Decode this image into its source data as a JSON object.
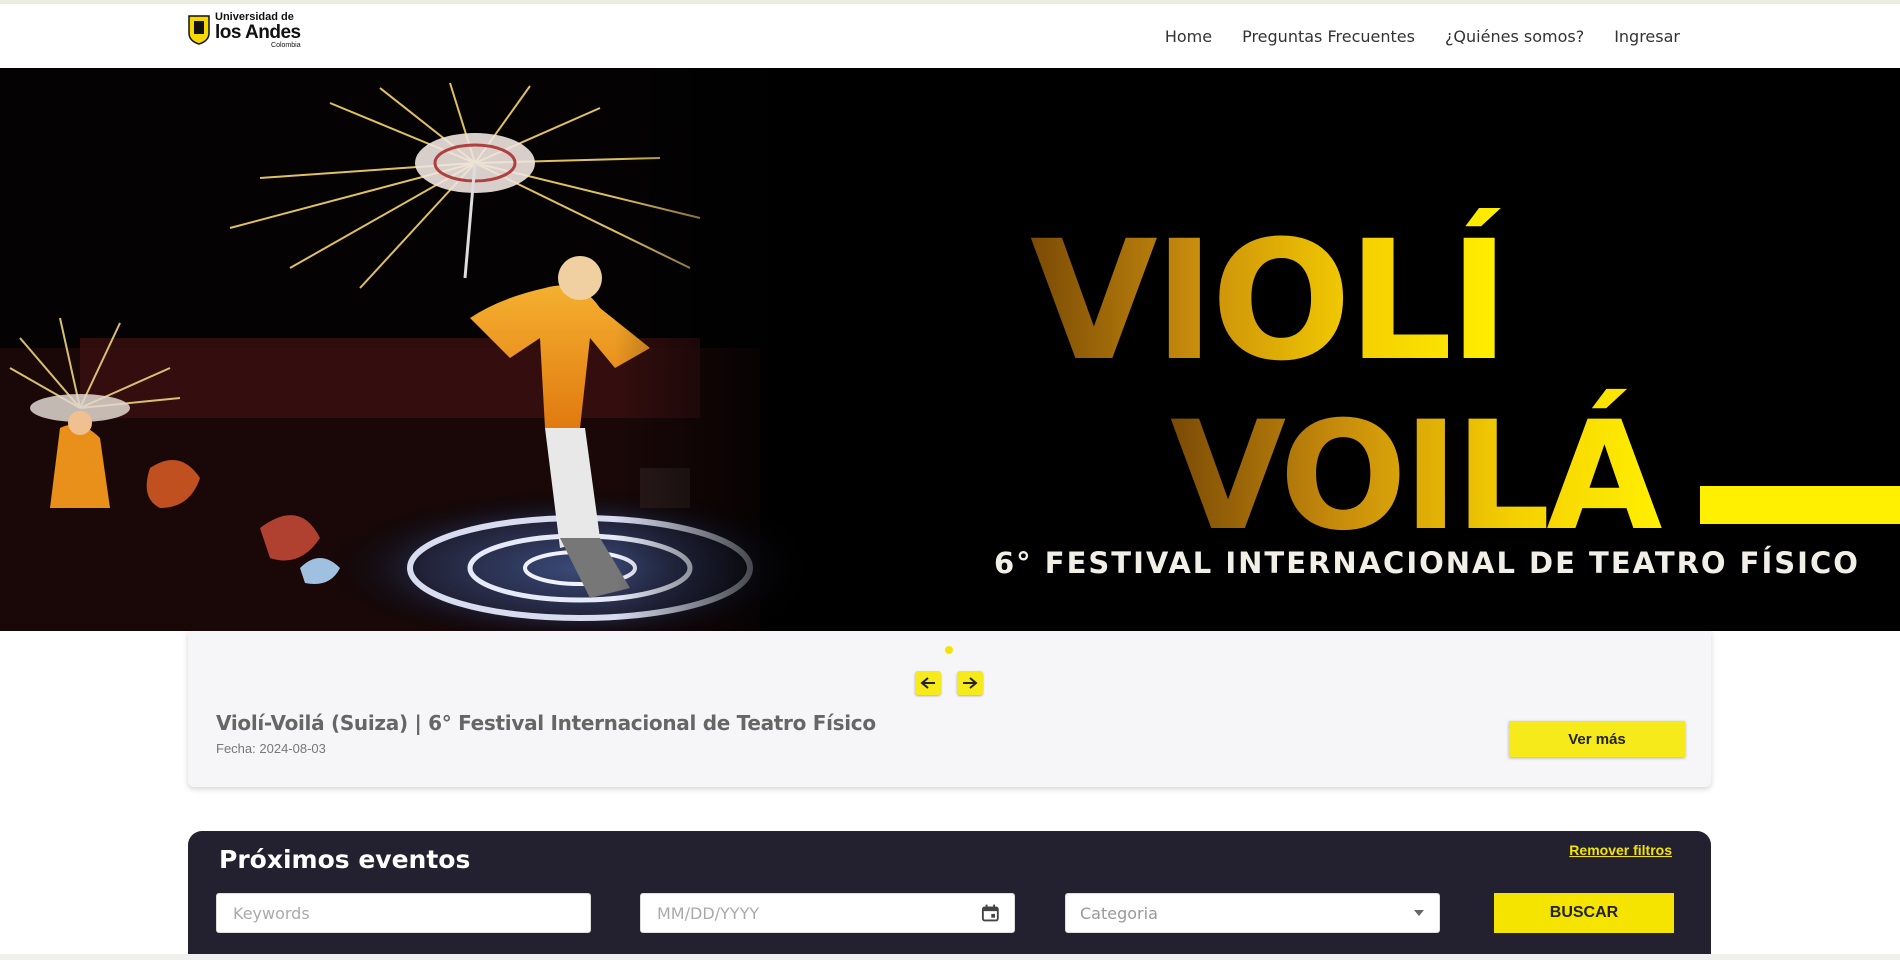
{
  "header": {
    "logo": {
      "line1": "Universidad de",
      "line2": "los Andes",
      "line3": "Colombia"
    },
    "nav": [
      "Home",
      "Preguntas Frecuentes",
      "¿Quiénes somos?",
      "Ingresar"
    ]
  },
  "hero": {
    "title_line1": "VIOLÍ",
    "title_line2": "VOILÁ",
    "subtitle": "6° FESTIVAL INTERNACIONAL DE TEATRO FÍSICO"
  },
  "featured": {
    "title": "Violí-Voilá (Suiza) | 6° Festival Internacional de Teatro Físico",
    "date_label": "Fecha:",
    "date": "2024-08-03",
    "button": "Ver más",
    "prev_icon": "arrow-left-icon",
    "next_icon": "arrow-right-icon"
  },
  "events": {
    "title": "Próximos eventos",
    "remove_filters": "Remover filtros",
    "keywords_placeholder": "Keywords",
    "date_placeholder": "MM/DD/YYYY",
    "category_placeholder": "Categoria",
    "search_button": "BUSCAR"
  },
  "colors": {
    "accent": "#f5e400",
    "dark": "#23212f"
  }
}
